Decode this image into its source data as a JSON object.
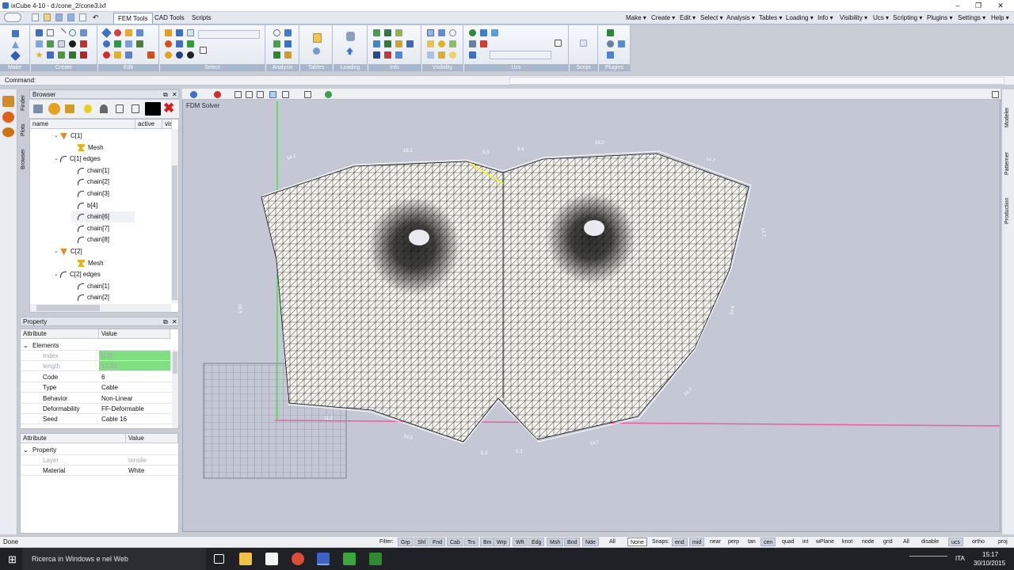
{
  "window": {
    "title": "ixCube 4-10 - d:/cone_2/cone3.ixf",
    "minimize": "–",
    "restore": "❐",
    "close": "✕"
  },
  "menu": {
    "tabs": [
      {
        "label": "FEM Tools"
      },
      {
        "label": "CAD Tools"
      },
      {
        "label": "Scripts"
      }
    ],
    "right_items": [
      {
        "label": "Make ▾"
      },
      {
        "label": "Create ▾"
      },
      {
        "label": "Edit ▾"
      },
      {
        "label": "Select ▾"
      },
      {
        "label": "Analysis ▾"
      },
      {
        "label": "Tables ▾"
      },
      {
        "label": "Loading ▾"
      },
      {
        "label": "Info ▾"
      },
      {
        "label": "Visibility ▾"
      },
      {
        "label": "Ucs ▾"
      },
      {
        "label": "Scripting ▾"
      },
      {
        "label": "Plugins ▾"
      },
      {
        "label": "Settings ▾"
      },
      {
        "label": "Help ▾"
      }
    ]
  },
  "ribbon": {
    "groups": [
      {
        "label": "Make"
      },
      {
        "label": "Create"
      },
      {
        "label": "Edit"
      },
      {
        "label": "Select"
      },
      {
        "label": "Analysis"
      },
      {
        "label": "Tables"
      },
      {
        "label": "Loading"
      },
      {
        "label": "Info"
      },
      {
        "label": "Visibility"
      },
      {
        "label": "Ucs"
      },
      {
        "label": "Script"
      },
      {
        "label": "Plugins"
      }
    ]
  },
  "command": {
    "label": "Command:"
  },
  "side_tabs": {
    "finder": "Finder",
    "plots": "Plots",
    "browser": "Browser"
  },
  "right_tabs": {
    "modeler": "Modeler",
    "patterner": "Patterner",
    "production": "Production"
  },
  "browser": {
    "title": "Browser",
    "columns": [
      "name",
      "active",
      "vis"
    ],
    "rows": [
      {
        "label": "C[1]",
        "icon": "cone",
        "indent": 1,
        "expander": "⌄"
      },
      {
        "label": "Mesh",
        "icon": "mesh",
        "indent": 2,
        "expander": ""
      },
      {
        "label": "C[1] edges",
        "icon": "edge",
        "indent": 1,
        "expander": "⌄"
      },
      {
        "label": "chain[1]",
        "icon": "edge",
        "indent": 2,
        "expander": ""
      },
      {
        "label": "chain[2]",
        "icon": "edge",
        "indent": 2,
        "expander": ""
      },
      {
        "label": "chain[3]",
        "icon": "edge",
        "indent": 2,
        "expander": ""
      },
      {
        "label": "b[4]",
        "icon": "edge",
        "indent": 2,
        "expander": ""
      },
      {
        "label": "chain[6]",
        "icon": "edge",
        "indent": 2,
        "expander": "",
        "highlight": true
      },
      {
        "label": "chain[7]",
        "icon": "edge",
        "indent": 2,
        "expander": ""
      },
      {
        "label": "chain[8]",
        "icon": "edge",
        "indent": 2,
        "expander": ""
      },
      {
        "label": "C[2]",
        "icon": "cone",
        "indent": 1,
        "expander": "⌄"
      },
      {
        "label": "Mesh",
        "icon": "mesh",
        "indent": 2,
        "expander": ""
      },
      {
        "label": "C[2] edges",
        "icon": "edge",
        "indent": 1,
        "expander": "⌄"
      },
      {
        "label": "chain[1]",
        "icon": "edge",
        "indent": 2,
        "expander": ""
      },
      {
        "label": "chain[2]",
        "icon": "edge",
        "indent": 2,
        "expander": ""
      }
    ]
  },
  "property": {
    "title": "Property",
    "columns": [
      "Attribute",
      "Value"
    ],
    "section": "Elements",
    "rows": [
      {
        "attribute": "Index",
        "value": "[13]",
        "dim": true,
        "green": true
      },
      {
        "attribute": "length",
        "value": "12.01",
        "dim": true,
        "green": true
      },
      {
        "attribute": "Code",
        "value": "6"
      },
      {
        "attribute": "Type",
        "value": "Cable"
      },
      {
        "attribute": "Behavior",
        "value": "Non-Linear"
      },
      {
        "attribute": "Deformability",
        "value": "FF-Deformable"
      },
      {
        "attribute": "Seed",
        "value": "Cable 16"
      }
    ]
  },
  "property2": {
    "columns": [
      "Attribute",
      "Value"
    ],
    "section": "Property",
    "rows": [
      {
        "attribute": "Layer",
        "value": "tensile",
        "dim": true
      },
      {
        "attribute": "Material",
        "value": "White"
      }
    ]
  },
  "viewport": {
    "label": "FDM Solver",
    "dimensions": [
      "14.2",
      "16.2",
      "5.3",
      "5.4",
      "16.2",
      "14.7",
      "14.7",
      "14.6",
      "14.7",
      "14.7",
      "5.3",
      "5.3",
      "14.3",
      "11.2",
      "16.5"
    ]
  },
  "status": {
    "message": "Done",
    "filter_label": "Filter:",
    "filters": [
      "Grp",
      "Shl",
      "Fnd",
      "Cab",
      "Trs",
      "Bm",
      "Wrp",
      "Wft",
      "Edg",
      "Msh",
      "Bnd",
      "Nde"
    ],
    "all": "All",
    "none": "None",
    "snaps_label": "Snaps:",
    "snaps": [
      {
        "label": "end",
        "on": true
      },
      {
        "label": "mid",
        "on": true
      },
      {
        "label": "near",
        "on": false
      },
      {
        "label": "perp",
        "on": false
      },
      {
        "label": "tan",
        "on": false
      },
      {
        "label": "cen",
        "on": true
      },
      {
        "label": "quad",
        "on": false
      },
      {
        "label": "int",
        "on": false
      },
      {
        "label": "wPlane",
        "on": false
      },
      {
        "label": "knot",
        "on": false
      },
      {
        "label": "node",
        "on": false
      },
      {
        "label": "grid",
        "on": false
      }
    ],
    "snap_all": "All",
    "disable": "disable",
    "ucs": "ucs",
    "ortho": "ortho",
    "proj": "proj"
  },
  "taskbar": {
    "search": "Ricerca in Windows e nel Web",
    "lang": "ITA",
    "time": "15:17",
    "date": "30/10/2015"
  }
}
